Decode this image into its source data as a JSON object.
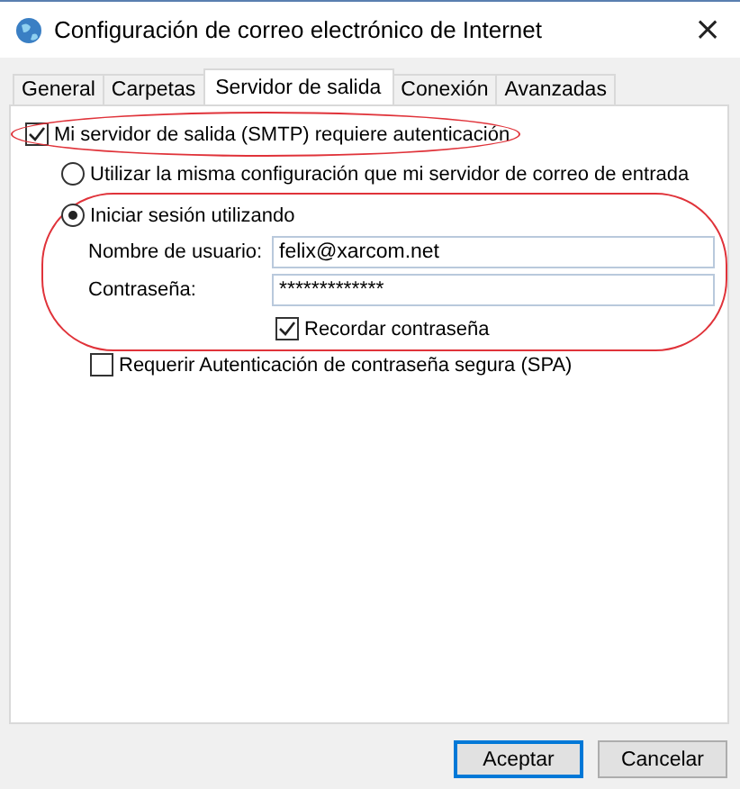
{
  "window": {
    "title": "Configuración de correo electrónico de Internet",
    "close": "×"
  },
  "tabs": [
    {
      "label": "General",
      "selected": false
    },
    {
      "label": "Carpetas",
      "selected": false
    },
    {
      "label": "Servidor de salida",
      "selected": true
    },
    {
      "label": "Conexión",
      "selected": false
    },
    {
      "label": "Avanzadas",
      "selected": false
    }
  ],
  "smtp_auth": {
    "label": "Mi servidor de salida (SMTP) requiere autenticación",
    "checked": true,
    "highlighted": true
  },
  "same_settings": {
    "label": "Utilizar la misma configuración que mi servidor de correo de entrada",
    "selected": false
  },
  "login": {
    "label": "Iniciar sesión utilizando",
    "selected": true,
    "highlighted": true,
    "username": {
      "label": "Nombre de usuario:",
      "value": "felix@xarcom.net"
    },
    "password": {
      "label": "Contraseña:",
      "value": "*************"
    },
    "remember": {
      "label": "Recordar contraseña",
      "checked": true
    }
  },
  "spa": {
    "label": "Requerir Autenticación de contraseña segura (SPA)",
    "checked": false
  },
  "buttons": [
    {
      "label": "Aceptar",
      "default": true
    },
    {
      "label": "Cancelar",
      "default": false
    }
  ]
}
